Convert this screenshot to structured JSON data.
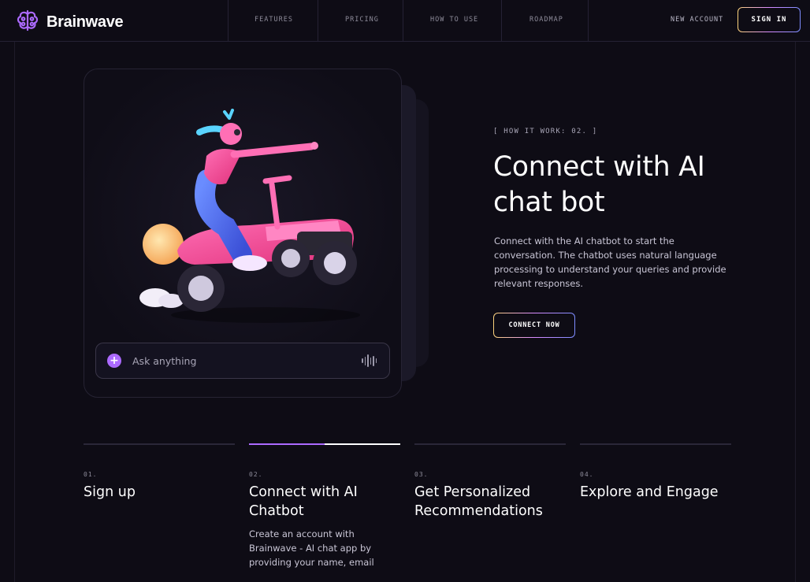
{
  "brand": {
    "name": "Brainwave",
    "accent": "#ac6aff"
  },
  "nav": {
    "items": [
      "FEATURES",
      "PRICING",
      "HOW TO USE",
      "ROADMAP"
    ],
    "new_account": "NEW ACCOUNT",
    "sign_in": "SIGN IN"
  },
  "hero": {
    "tag": "[ HOW IT WORK: 02. ]",
    "title": "Connect with AI chat bot",
    "description": "Connect with the AI chatbot to start the conversation. The chatbot uses natural language processing to understand your queries and provide relevant responses.",
    "cta": "CONNECT NOW"
  },
  "chat": {
    "placeholder": "Ask anything",
    "add_icon": "plus-icon",
    "voice_icon": "soundwave-icon"
  },
  "steps": [
    {
      "num": "01.",
      "title": "Sign up",
      "desc": ""
    },
    {
      "num": "02.",
      "title": "Connect with AI Chatbot",
      "desc": "Create an account with Brainwave - AI chat app by providing your name, email",
      "progress": 0.5
    },
    {
      "num": "03.",
      "title": "Get Personalized Recommendations",
      "desc": ""
    },
    {
      "num": "04.",
      "title": "Explore and Engage",
      "desc": ""
    }
  ]
}
